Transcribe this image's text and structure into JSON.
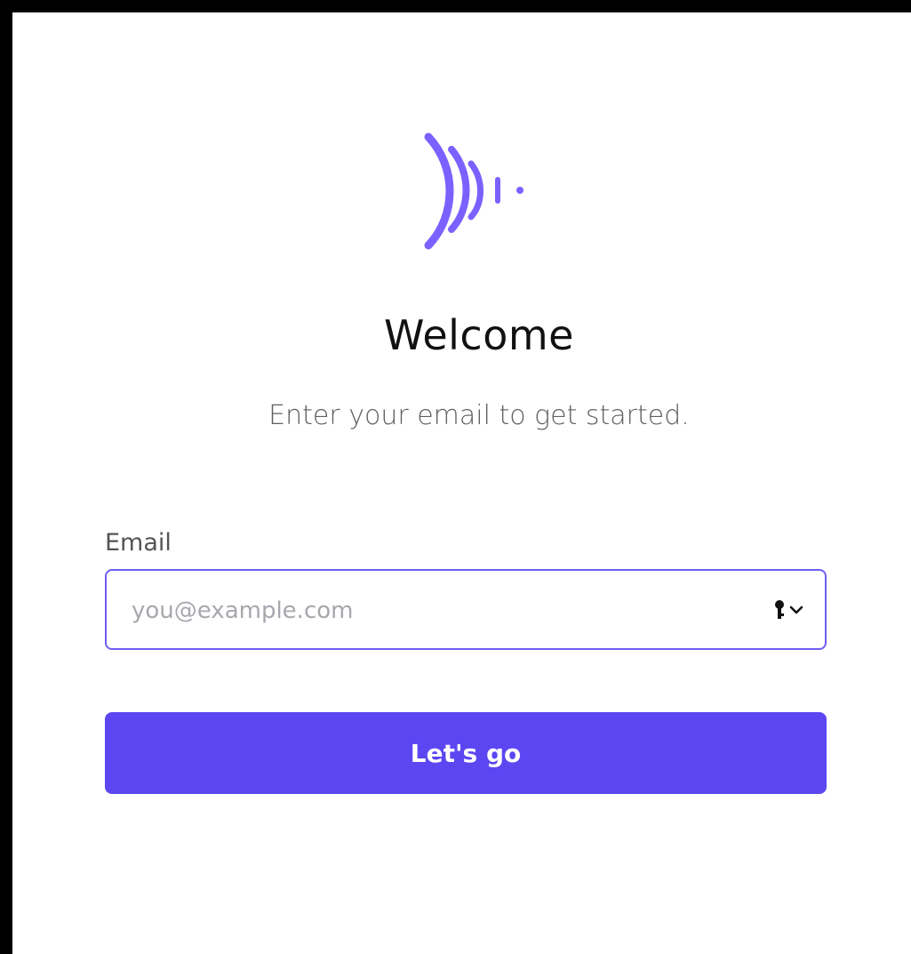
{
  "brand": {
    "logo_icon": "sound-wave-logo-icon",
    "accent_color": "#6f5df4",
    "button_color": "#5b46f2"
  },
  "header": {
    "title": "Welcome",
    "subtitle": "Enter your email to get started."
  },
  "form": {
    "email_label": "Email",
    "email_value": "",
    "email_placeholder": "you@example.com",
    "autofill_icons": [
      "key-icon",
      "chevron-down-icon"
    ],
    "submit_label": "Let's go"
  }
}
